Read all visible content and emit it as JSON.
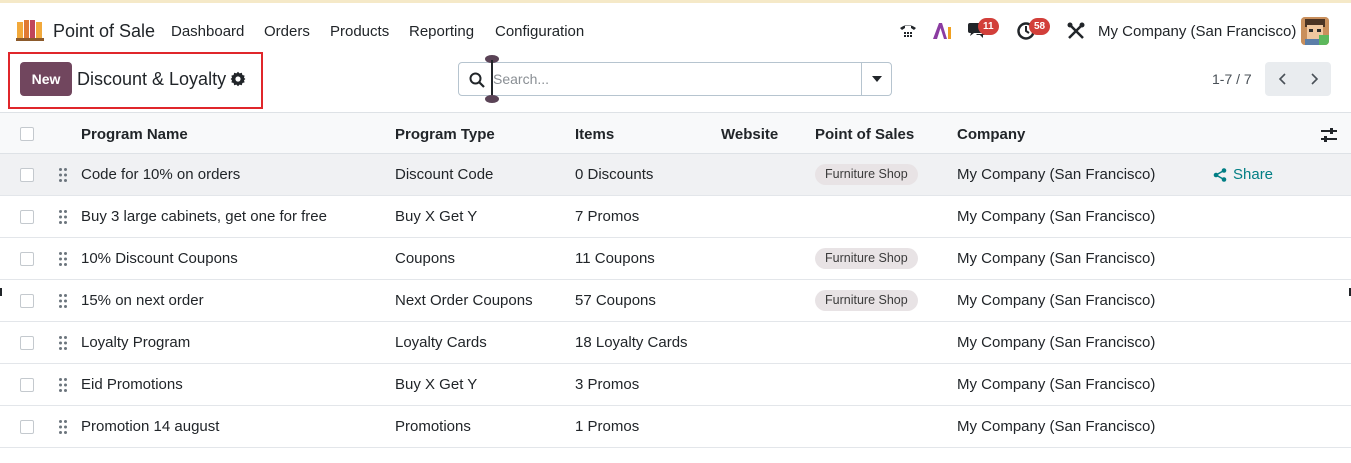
{
  "app": {
    "name": "Point of Sale"
  },
  "nav": [
    {
      "label": "Dashboard"
    },
    {
      "label": "Orders"
    },
    {
      "label": "Products"
    },
    {
      "label": "Reporting"
    },
    {
      "label": "Configuration"
    }
  ],
  "systray": {
    "messages_count": "11",
    "activities_count": "58",
    "company": "My Company (San Francisco)"
  },
  "control": {
    "new_label": "New",
    "title": "Discount & Loyalty",
    "search_placeholder": "Search...",
    "pager": "1-7 / 7"
  },
  "columns": {
    "name": "Program Name",
    "type": "Program Type",
    "items": "Items",
    "website": "Website",
    "pos": "Point of Sales",
    "company": "Company"
  },
  "rows": [
    {
      "name": "Code for 10% on orders",
      "type": "Discount Code",
      "items": "0 Discounts",
      "pos": "Furniture Shop",
      "company": "My Company (San Francisco)",
      "action": "Share"
    },
    {
      "name": "Buy 3 large cabinets, get one for free",
      "type": "Buy X Get Y",
      "items": "7 Promos",
      "pos": "",
      "company": "My Company (San Francisco)"
    },
    {
      "name": "10% Discount Coupons",
      "type": "Coupons",
      "items": "11 Coupons",
      "pos": "Furniture Shop",
      "company": "My Company (San Francisco)"
    },
    {
      "name": "15% on next order",
      "type": "Next Order Coupons",
      "items": "57 Coupons",
      "pos": "Furniture Shop",
      "company": "My Company (San Francisco)"
    },
    {
      "name": "Loyalty Program",
      "type": "Loyalty Cards",
      "items": "18 Loyalty Cards",
      "pos": "",
      "company": "My Company (San Francisco)"
    },
    {
      "name": "Eid Promotions",
      "type": "Buy X Get Y",
      "items": "3 Promos",
      "pos": "",
      "company": "My Company (San Francisco)"
    },
    {
      "name": "Promotion 14 august",
      "type": "Promotions",
      "items": "1 Promos",
      "pos": "",
      "company": "My Company (San Francisco)"
    }
  ],
  "colors": {
    "brand": "#71465e",
    "highlight": "#e0262b",
    "badge": "#d23f3a",
    "link": "#017e84"
  },
  "icons": [
    "pos-logo-icon",
    "phone-icon",
    "ai-icon",
    "chat-icon",
    "clock-icon",
    "tools-icon",
    "gear-icon",
    "search-icon",
    "caret-down-icon",
    "chevron-left-icon",
    "chevron-right-icon",
    "column-options-icon",
    "drag-handle-icon",
    "share-icon"
  ]
}
